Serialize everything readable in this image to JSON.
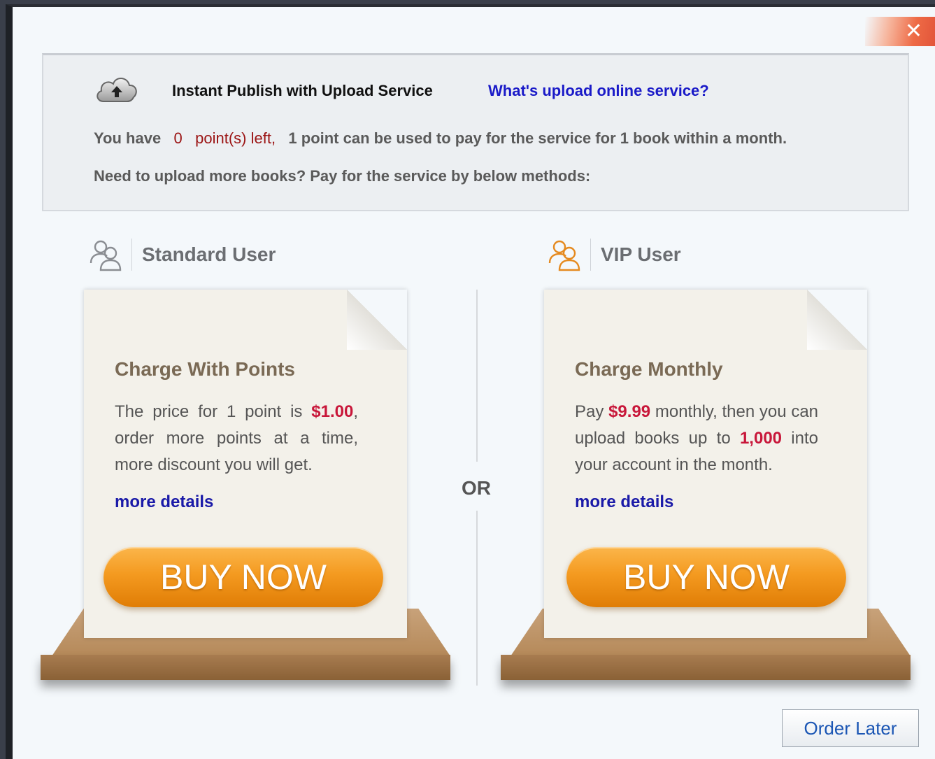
{
  "close_label": "✕",
  "info": {
    "title": "Instant Publish with Upload Service",
    "link": "What's upload online service?",
    "you_have": "You have",
    "points": "0",
    "points_left": "point(s) left,",
    "points_rule": "1 point can be used to pay for the service for 1 book within a month.",
    "need_more": "Need to upload more books? Pay for the service by below methods:"
  },
  "or_label": "OR",
  "standard": {
    "label": "Standard User",
    "card_title": "Charge With Points",
    "text_1": "The price for 1 point is",
    "price": "$1.00",
    "text_2": ", order more points at a time, more discount you will get.",
    "more_details": "more details",
    "buy_label": "BUY NOW"
  },
  "vip": {
    "label": "VIP User",
    "card_title": "Charge Monthly",
    "text_1": "Pay",
    "price": "$9.99",
    "text_2": "monthly, then you can upload books up to",
    "limit": "1,000",
    "text_3": "into your account in the month.",
    "more_details": "more details",
    "buy_label": "BUY NOW"
  },
  "order_later_label": "Order Later",
  "colors": {
    "accent_orange": "#f49a20",
    "price_red": "#c8173a",
    "link_blue": "#1a1ac8"
  }
}
